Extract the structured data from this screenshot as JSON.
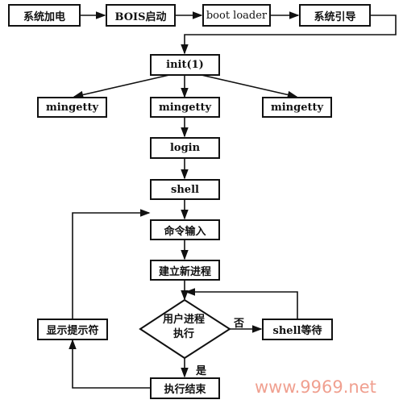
{
  "nodes": {
    "power_on": "系统加电",
    "bios": "BOIS启动",
    "boot_loader": "boot loader",
    "system_boot": "系统引导",
    "init": "init(1)",
    "mingetty_1": "mingetty",
    "mingetty_2": "mingetty",
    "mingetty_3": "mingetty",
    "login": "login",
    "shell": "shell",
    "command_input": "命令输入",
    "new_process": "建立新进程",
    "decision_line1": "用户进程",
    "decision_line2": "执行",
    "shell_wait": "shell等待",
    "show_prompt": "显示提示符",
    "exec_end": "执行结束"
  },
  "edge_labels": {
    "no": "否",
    "yes": "是"
  },
  "watermark": "www.9969.net"
}
